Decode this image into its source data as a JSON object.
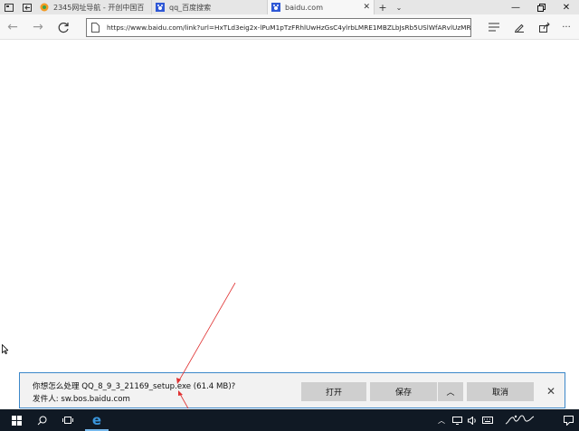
{
  "tabs": [
    {
      "title": "2345网址导航 - 开创中国百",
      "active": false
    },
    {
      "title": "qq_百度搜索",
      "active": false
    },
    {
      "title": "baidu.com",
      "active": true
    }
  ],
  "address_bar": {
    "url": "https://www.baidu.com/link?url=HxTLd3eig2x-lPuM1pTzFRhlUwHzGsC4ylrbLMRE1MBZLbJsRb5USlWfARvlUzMR"
  },
  "download_bar": {
    "question": "你想怎么处理 QQ_8_9_3_21169_setup.exe (61.4 MB)?",
    "publisher": "发件人: sw.bos.baidu.com",
    "open_label": "打开",
    "save_label": "保存",
    "cancel_label": "取消"
  },
  "colors": {
    "accent": "#3b87c9",
    "annotation": "#e03030",
    "taskbar": "#101924"
  }
}
